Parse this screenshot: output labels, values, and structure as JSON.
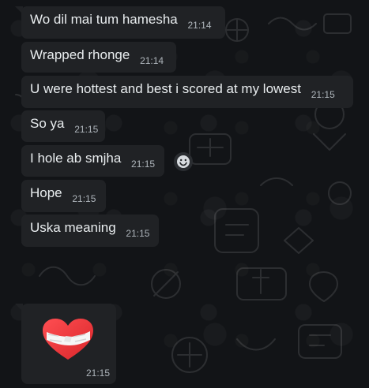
{
  "messages": [
    {
      "text": "Wo dil mai tum hamesha",
      "time": "21:14"
    },
    {
      "text": "Wrapped rhonge",
      "time": "21:14"
    },
    {
      "text": "U were hottest and best i scored at my lowest",
      "time": "21:15"
    },
    {
      "text": "So ya",
      "time": "21:15"
    },
    {
      "text": "I hole ab smjha",
      "time": "21:15"
    },
    {
      "text": "Hope",
      "time": "21:15"
    },
    {
      "text": "Uska meaning",
      "time": "21:15"
    }
  ],
  "sticker": {
    "time": "21:15",
    "icon": "bandaged-heart-icon"
  },
  "react_button": {
    "icon": "smiley-icon"
  },
  "colors": {
    "background": "#111418",
    "bubble": "#202225",
    "text": "#e9edef",
    "time": "#aeb5bb",
    "heart": "#e53935"
  }
}
